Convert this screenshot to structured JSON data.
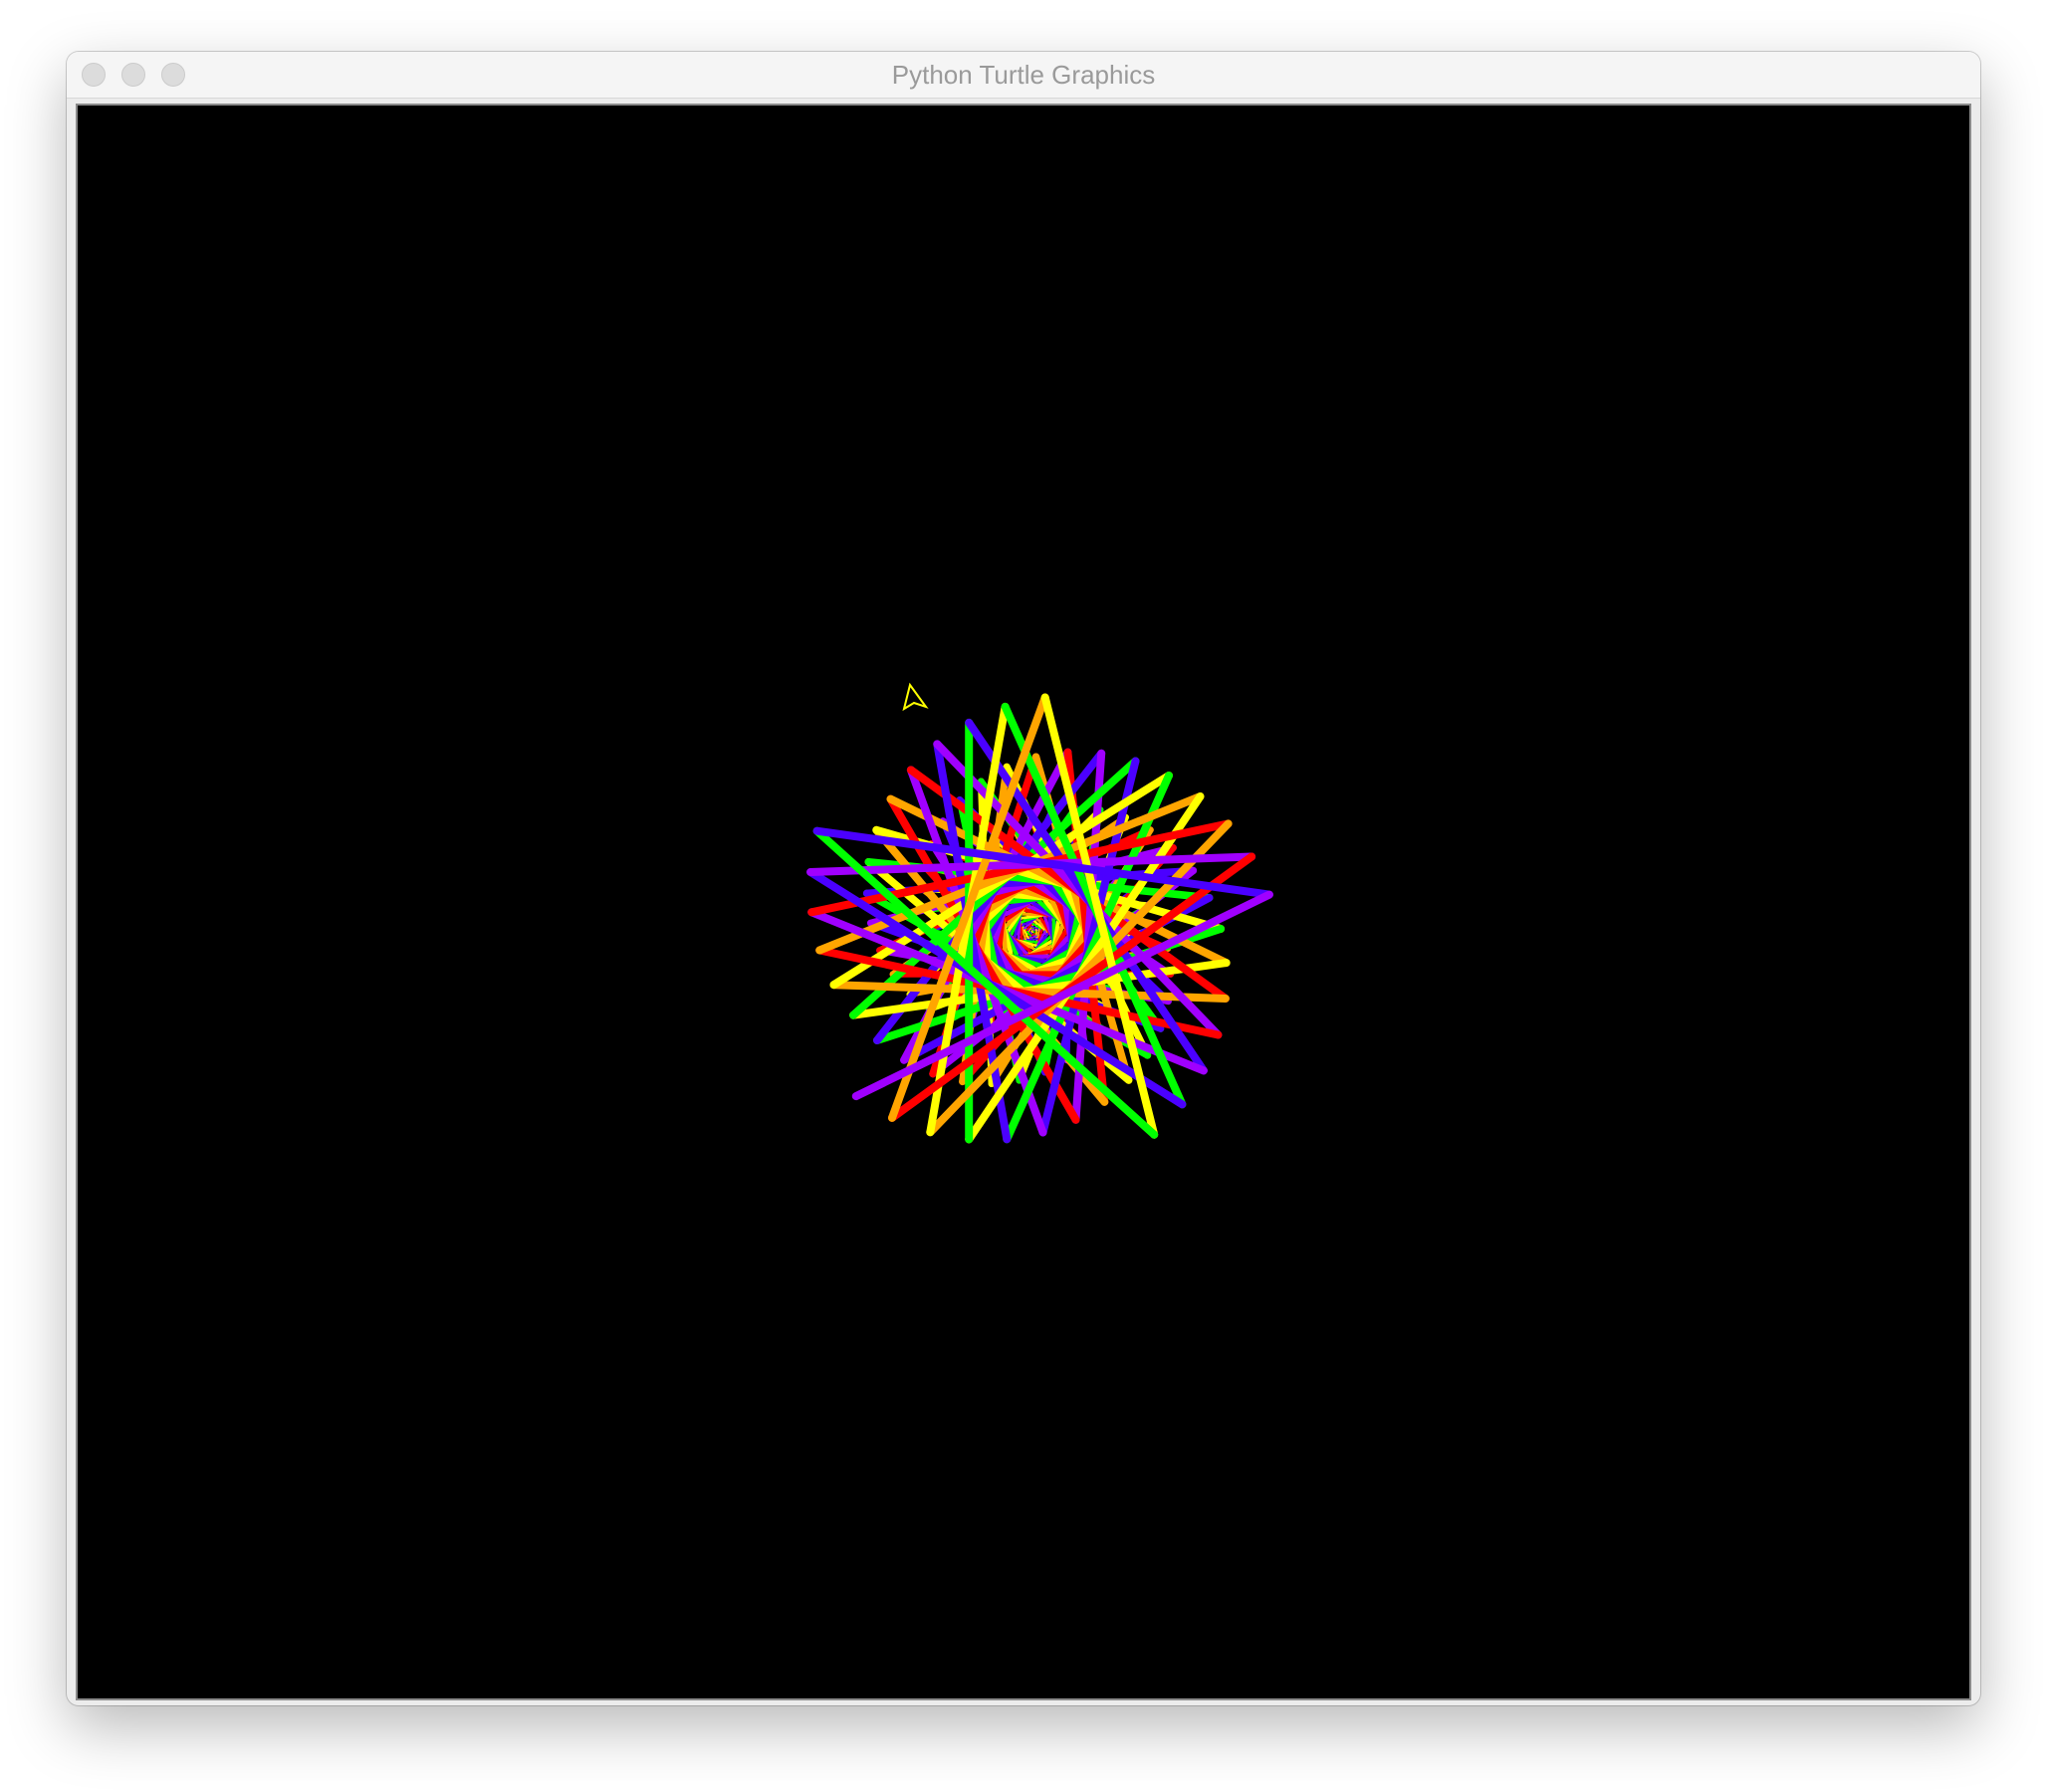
{
  "window": {
    "title": "Python Turtle Graphics"
  },
  "canvas": {
    "background": "#000000",
    "pen_colors": [
      "#ff0000",
      "#ffa500",
      "#ffff00",
      "#00ff00",
      "#4b00ff",
      "#a000ff"
    ],
    "turtle_color": "#ffff00"
  },
  "icons": {
    "close": "close-traffic-light",
    "minimize": "minimize-traffic-light",
    "zoom": "zoom-traffic-light",
    "turtle": "turtle-arrow-cursor"
  }
}
